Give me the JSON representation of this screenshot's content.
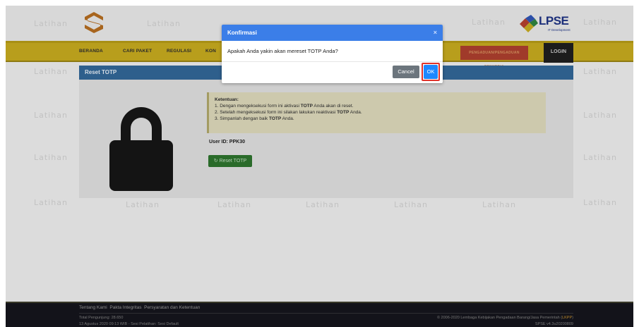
{
  "watermark": "Latihan",
  "nav": {
    "items": [
      "BERANDA",
      "CARI PAKET",
      "REGULASI",
      "KON"
    ],
    "red_button": "PENGADUAN/PENGADUAN PENYEDIA",
    "login": "LOGIN"
  },
  "logo": {
    "brand": "LPSE",
    "subtitle": "IT Development"
  },
  "panel": {
    "title": "Reset TOTP",
    "info": {
      "title": "Ketentuan:",
      "line1_pre": "1. Dengan mengeksekusi form ini aktivasi ",
      "line1_bold": "TOTP",
      "line1_post": " Anda akan di reset.",
      "line2_pre": "2. Setelah mengeksekusi form ini silakan lakukan reaktivasi ",
      "line2_bold": "TOTP",
      "line2_post": " Anda.",
      "line3_pre": "3. Simpanlah dengan baik ",
      "line3_bold": "TOTP",
      "line3_post": " Anda."
    },
    "user_id_label": "User ID:",
    "user_id": "PPK30",
    "reset_button": "Reset TOTP"
  },
  "modal": {
    "title": "Konfirmasi",
    "close": "×",
    "message": "Apakah Anda yakin akan mereset TOTP Anda?",
    "cancel": "Cancel",
    "ok": "OK"
  },
  "footer": {
    "links": [
      "Tentang Kami",
      "Pakta Integritas",
      "Persyaratan dan Ketentuan"
    ],
    "visitors": "Total Pengunjung: 28.650",
    "session": "13 Agustus 2020 09:13 WIB - Sesi Pelatihan: Sesi Default",
    "copyright_pre": "© 2006-2020 Lembaga Kebijakan Pengadaan Barang/Jasa Pemerintah (",
    "copyright_link": "LKPP",
    "copyright_post": ")",
    "version": "SPSE v4.3u20200809"
  },
  "colors": {
    "modal_header": "#3b7ee8",
    "ok_button": "#1e88ff",
    "highlight": "#e0322a",
    "nav_bar": "#b89e1c",
    "panel_header": "#2e5f8c",
    "reset_button": "#2a6b2a"
  },
  "icons": {
    "lock": "lock-icon",
    "reset": "refresh-icon",
    "close": "close-icon"
  }
}
